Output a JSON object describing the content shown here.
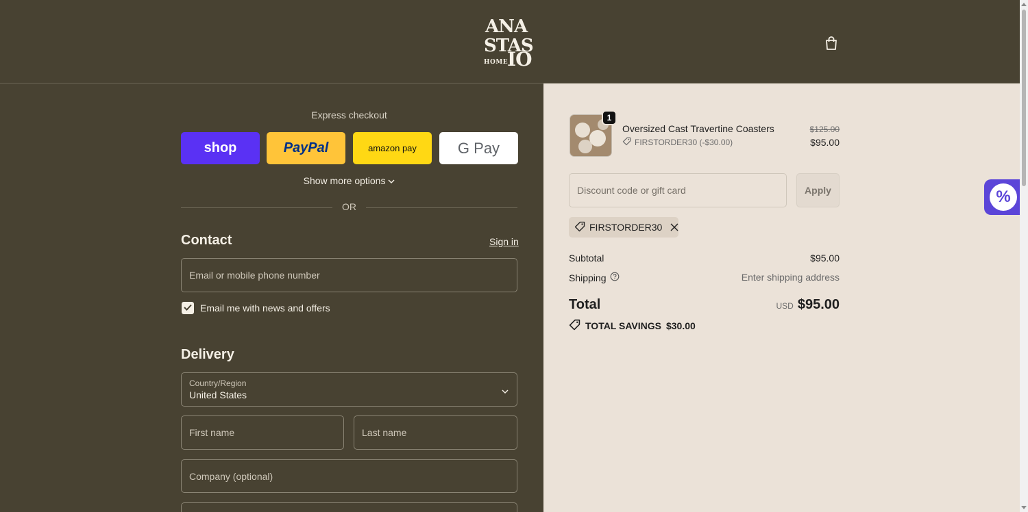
{
  "brand": {
    "logo_line1": "ANA",
    "logo_line2": "STAS",
    "logo_line3": "IO",
    "logo_home": "HOME"
  },
  "express": {
    "title": "Express checkout",
    "shop_label": "shop",
    "paypal_label": "PayPal",
    "amazon_label": "amazon pay",
    "gpay_label": "G Pay",
    "show_more": "Show more options",
    "or_text": "OR"
  },
  "contact": {
    "title": "Contact",
    "sign_in": "Sign in",
    "email_placeholder": "Email or mobile phone number",
    "newsletter_label": "Email me with news and offers",
    "newsletter_checked": true
  },
  "delivery": {
    "title": "Delivery",
    "country_label": "Country/Region",
    "country_value": "United States",
    "first_name_placeholder": "First name",
    "last_name_placeholder": "Last name",
    "company_placeholder": "Company (optional)"
  },
  "summary": {
    "item": {
      "quantity": "1",
      "name": "Oversized Cast Travertine Coasters",
      "discount_line": "FIRSTORDER30 (-$30.00)",
      "original_price": "$125.00",
      "price": "$95.00"
    },
    "discount_placeholder": "Discount code or gift card",
    "apply_label": "Apply",
    "applied_code": "FIRSTORDER30",
    "subtotal_label": "Subtotal",
    "subtotal_value": "$95.00",
    "shipping_label": "Shipping",
    "shipping_value": "Enter shipping address",
    "total_label": "Total",
    "total_currency": "USD",
    "total_value": "$95.00",
    "savings_label": "TOTAL SAVINGS",
    "savings_value": "$30.00"
  },
  "colors": {
    "background": "#484232",
    "summary_background": "#ebe2d8",
    "shop": "#5a31f4",
    "paypal": "#ffc439",
    "amazon": "#ffd814"
  },
  "icons": [
    "shopping-bag-icon",
    "chevron-down-icon",
    "checkmark-icon",
    "tag-icon",
    "close-icon",
    "help-circle-icon",
    "discount-percent-icon"
  ]
}
